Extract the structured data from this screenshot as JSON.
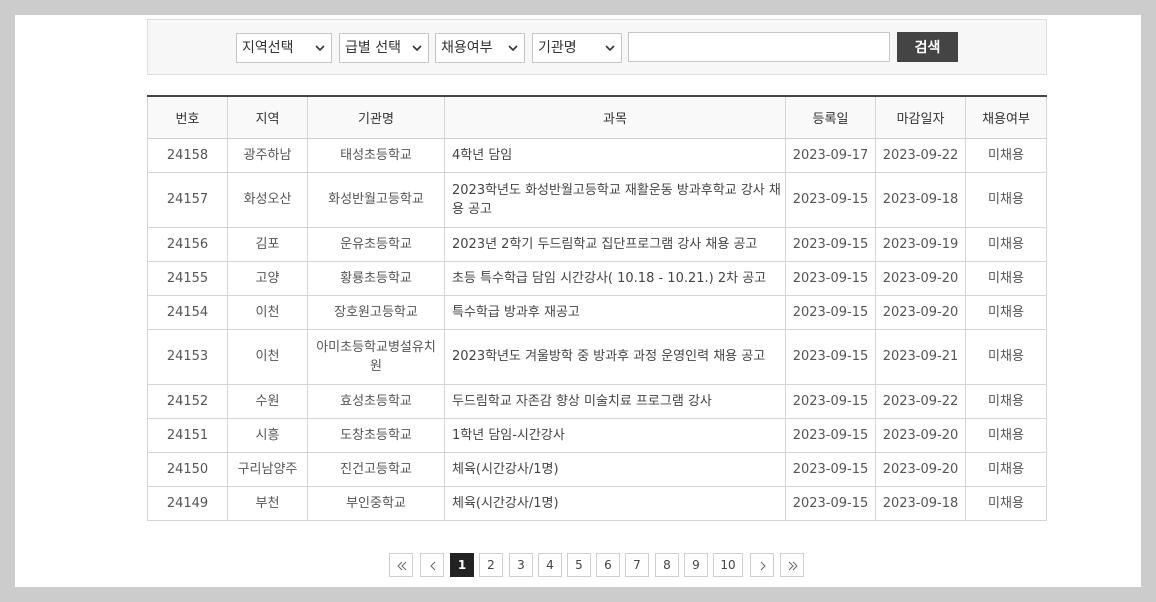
{
  "search": {
    "region_select": "지역선택",
    "grade_select": "급별 선택",
    "hire_select": "채용여부",
    "org_select": "기관명",
    "keyword_value": "",
    "button_label": "검색"
  },
  "table": {
    "headers": [
      "번호",
      "지역",
      "기관명",
      "과목",
      "등록일",
      "마감일자",
      "채용여부"
    ],
    "rows": [
      {
        "no": "24158",
        "region": "광주하남",
        "org": "태성초등학교",
        "subject": "4학년 담임",
        "reg": "2023-09-17",
        "due": "2023-09-22",
        "status": "미채용"
      },
      {
        "no": "24157",
        "region": "화성오산",
        "org": "화성반월고등학교",
        "subject": "2023학년도 화성반월고등학교 재활운동 방과후학교 강사 채용 공고",
        "reg": "2023-09-15",
        "due": "2023-09-18",
        "status": "미채용"
      },
      {
        "no": "24156",
        "region": "김포",
        "org": "운유초등학교",
        "subject": "2023년 2학기 두드림학교 집단프로그램 강사 채용 공고",
        "reg": "2023-09-15",
        "due": "2023-09-19",
        "status": "미채용"
      },
      {
        "no": "24155",
        "region": "고양",
        "org": "황룡초등학교",
        "subject": "초등 특수학급 담임 시간강사( 10.18 - 10.21.) 2차 공고",
        "reg": "2023-09-15",
        "due": "2023-09-20",
        "status": "미채용"
      },
      {
        "no": "24154",
        "region": "이천",
        "org": "장호원고등학교",
        "subject": "특수학급 방과후 재공고",
        "reg": "2023-09-15",
        "due": "2023-09-20",
        "status": "미채용"
      },
      {
        "no": "24153",
        "region": "이천",
        "org": "아미초등학교병설유치원",
        "subject": "2023학년도 겨울방학 중 방과후 과정 운영인력 채용 공고",
        "reg": "2023-09-15",
        "due": "2023-09-21",
        "status": "미채용"
      },
      {
        "no": "24152",
        "region": "수원",
        "org": "효성초등학교",
        "subject": "두드림학교 자존감 향상 미술치료 프로그램 강사",
        "reg": "2023-09-15",
        "due": "2023-09-22",
        "status": "미채용"
      },
      {
        "no": "24151",
        "region": "시흥",
        "org": "도창초등학교",
        "subject": "1학년 담임-시간강사",
        "reg": "2023-09-15",
        "due": "2023-09-20",
        "status": "미채용"
      },
      {
        "no": "24150",
        "region": "구리남양주",
        "org": "진건고등학교",
        "subject": "체육(시간강사/1명)",
        "reg": "2023-09-15",
        "due": "2023-09-20",
        "status": "미채용"
      },
      {
        "no": "24149",
        "region": "부천",
        "org": "부인중학교",
        "subject": "체육(시간강사/1명)",
        "reg": "2023-09-15",
        "due": "2023-09-18",
        "status": "미채용"
      }
    ]
  },
  "pagination": {
    "pages": [
      "1",
      "2",
      "3",
      "4",
      "5",
      "6",
      "7",
      "8",
      "9",
      "10"
    ],
    "current": "1",
    "icons": {
      "first": "double-chevron-left-icon",
      "prev": "chevron-left-icon",
      "next": "chevron-right-icon",
      "last": "double-chevron-right-icon"
    }
  },
  "colors": {
    "search_button": "#444444",
    "active_page": "#222222",
    "background": "#cccccc"
  }
}
